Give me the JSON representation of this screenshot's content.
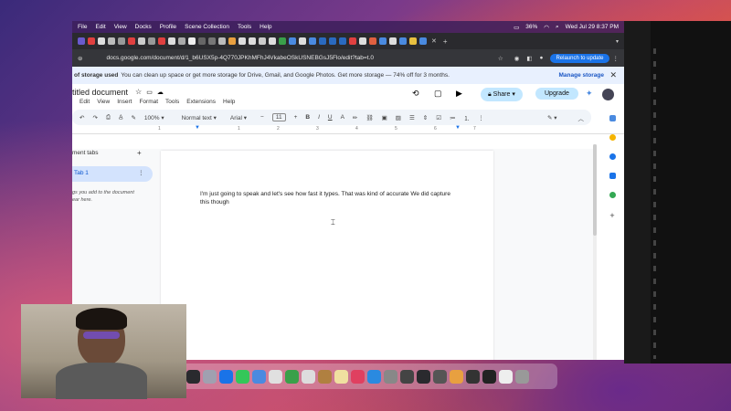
{
  "menubar": {
    "items": [
      "File",
      "Edit",
      "View",
      "Docks",
      "Profile",
      "Scene Collection",
      "Tools",
      "Help"
    ],
    "battery": "36%",
    "datetime": "Wed Jul 29  8:37 PM"
  },
  "browser": {
    "url": "docs.google.com/document/d/1_b6USX5p-4Q770JPKhMFhJ4VkabeOSkUSNEBGsJ5Flo/edit?tab=t.0",
    "relaunch_label": "Relaunch to update"
  },
  "storage_banner": {
    "bold": "of storage used",
    "message": "You can clean up space or get more storage for Drive, Gmail, and Google Photos. Get more storage — 74% off for 3 months.",
    "manage_label": "Manage storage",
    "close_glyph": "✕"
  },
  "doc": {
    "title": "titled document",
    "menus": [
      "Edit",
      "View",
      "Insert",
      "Format",
      "Tools",
      "Extensions",
      "Help"
    ],
    "share_label": "Share",
    "upgrade_label": "Upgrade",
    "toolbar": {
      "zoom": "100%",
      "style": "Normal text",
      "font": "Arial",
      "font_size": "11"
    },
    "ruler_numbers": [
      "1",
      "1",
      "2",
      "3",
      "4",
      "5",
      "6",
      "7"
    ],
    "side_panel": {
      "header": "ment tabs",
      "add_glyph": "+",
      "tab_label": "Tab 1",
      "hint_line1": "gs you add to the document",
      "hint_line2": "ear here."
    },
    "body_text_line1": "I'm just going to speak and let's see how fast it types. That was kind of accurate We did capture",
    "body_text_line2": "this though",
    "badge_count": "3"
  }
}
